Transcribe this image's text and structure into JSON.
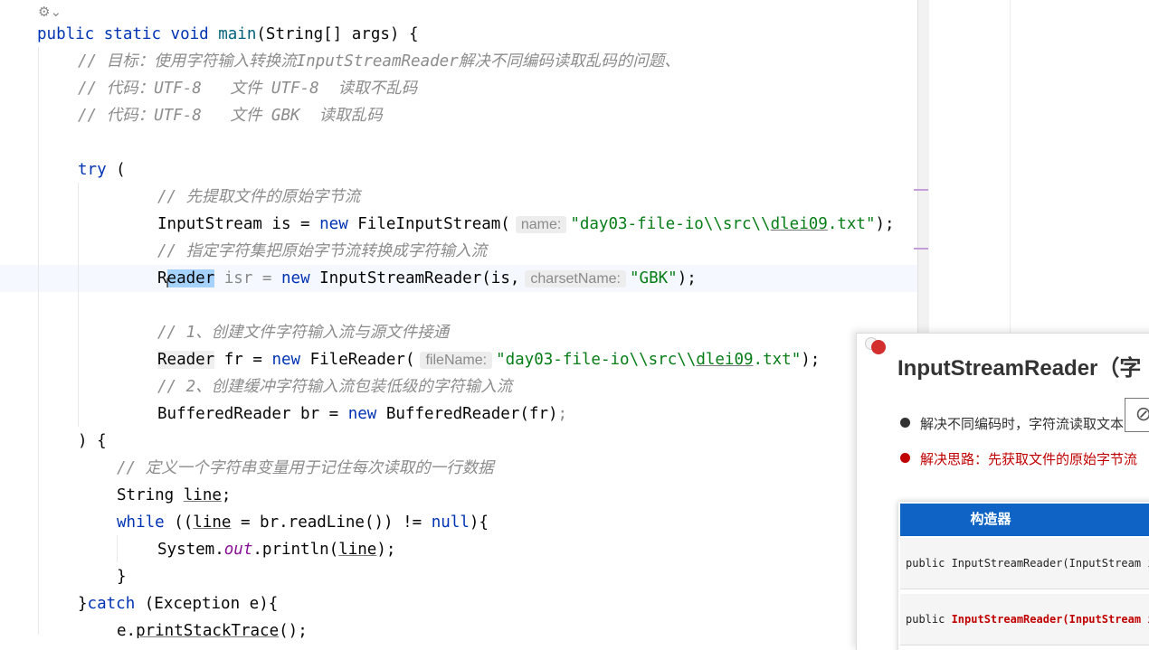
{
  "editor": {
    "lines": {
      "l1": {
        "t1": "public",
        "t2": "static",
        "t3": "void",
        "t4": "main",
        "t5": "(String[] args) {"
      },
      "l2": {
        "c": "// 目标：使用字符输入转换流InputStreamReader解决不同编码读取乱码的问题、"
      },
      "l3": {
        "c": "// 代码：UTF-8   文件 UTF-8  读取不乱码"
      },
      "l4": {
        "c": "// 代码：UTF-8   文件 GBK  读取乱码"
      },
      "l6": {
        "kw": "try",
        "rest": " ("
      },
      "l7": {
        "c": "// 先提取文件的原始字节流"
      },
      "l8": {
        "a": "InputStream is = ",
        "kw": "new",
        "b": " FileInputStream(",
        "hint": "name:",
        "str": "\"day03-file-io\\\\src\\\\",
        "ul": "dlei09",
        "str2": ".txt\"",
        "end": ");"
      },
      "l9": {
        "c": "// 指定字符集把原始字节流转换成字符输入流"
      },
      "l10": {
        "a": "R",
        "sel": "eader",
        "b": " isr = ",
        "kw": "new",
        "c2": " InputStreamReader(is,",
        "hint": "charsetName:",
        "str": "\"GBK\"",
        "end": ");"
      },
      "l12": {
        "c": "// 1、创建文件字符输入流与源文件接通"
      },
      "l13": {
        "a": "Reader",
        "b": " fr = ",
        "kw": "new",
        "c2": " FileReader(",
        "hint": "fileName:",
        "str": "\"day03-file-io\\\\src\\\\",
        "ul": "dlei09",
        "str2": ".txt\"",
        "end": ");"
      },
      "l14": {
        "c": "// 2、创建缓冲字符输入流包装低级的字符输入流"
      },
      "l15": {
        "a": "BufferedReader br = ",
        "kw": "new",
        "b": " BufferedReader(fr)",
        "end": ";"
      },
      "l16": {
        "a": ") {"
      },
      "l17": {
        "c": "// 定义一个字符串变量用于记住每次读取的一行数据"
      },
      "l18": {
        "a": "String ",
        "ul": "line",
        "end": ";"
      },
      "l19": {
        "kw": "while",
        "a": " ((",
        "ul": "line",
        "b": " = br.readLine()) != ",
        "kw2": "null",
        "end": "){"
      },
      "l20": {
        "a": "System.",
        "fld": "out",
        "b": ".println(",
        "ul": "line",
        "end": ");"
      },
      "l21": {
        "a": "}"
      },
      "l22": {
        "a": "}",
        "kw": "catch",
        "b": " (Exception e){"
      },
      "l23": {
        "a": "e.",
        "ul": "printStackTrace",
        "end": "();"
      }
    }
  },
  "slide": {
    "title": "InputStreamReader（字",
    "bullet1": "解决不同编码时，字符流读取文本",
    "bullet2": "解决思路：先获取文件的原始字节流",
    "table_header": "构造器",
    "row1": "public InputStreamReader(InputStream i",
    "row2_prefix": "public ",
    "row2_red": "InputStreamReader(InputStream i",
    "bullet1_color": "#333333",
    "bullet2_color": "#c00000"
  }
}
